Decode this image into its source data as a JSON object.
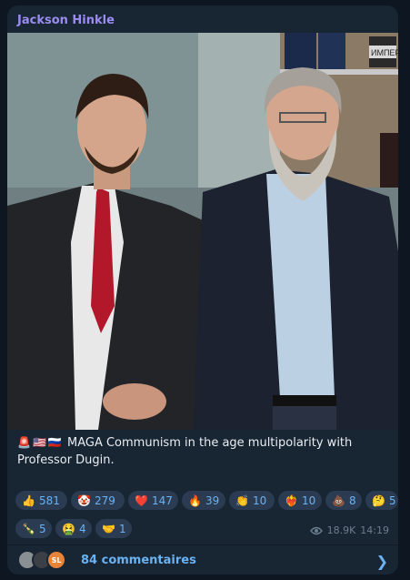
{
  "post": {
    "author": "Jackson Hinkle",
    "caption": "MAGA Communism in the age multipolarity with Professor Dugin.",
    "caption_flags": [
      "🚨",
      "🇺🇸",
      "🇷🇺"
    ],
    "reactions": [
      {
        "emoji": "👍",
        "count": "581"
      },
      {
        "emoji": "🤡",
        "count": "279"
      },
      {
        "emoji": "❤️",
        "count": "147"
      },
      {
        "emoji": "🔥",
        "count": "39"
      },
      {
        "emoji": "👏",
        "count": "10"
      },
      {
        "emoji": "❤️‍🔥",
        "count": "10"
      },
      {
        "emoji": "💩",
        "count": "8"
      },
      {
        "emoji": "🤔",
        "count": "5"
      },
      {
        "emoji": "🍾",
        "count": "5"
      },
      {
        "emoji": "🤮",
        "count": "4"
      },
      {
        "emoji": "🤝",
        "count": "1"
      }
    ],
    "views": "18.9K",
    "time": "14:19",
    "comments_label": "84 commentaires",
    "comment_avatar_initials": "SL",
    "book_title": "ИМПЕР"
  },
  "colors": {
    "background": "#0e1621",
    "card": "#182533",
    "author": "#9b8cf2",
    "link": "#6ab2f2",
    "pill": "#2a3b52",
    "meta": "#6d7f8f",
    "avatar_sl": "#e8833a"
  },
  "icons": {
    "views": "eye-icon",
    "chevron": "chevron-right-icon"
  }
}
